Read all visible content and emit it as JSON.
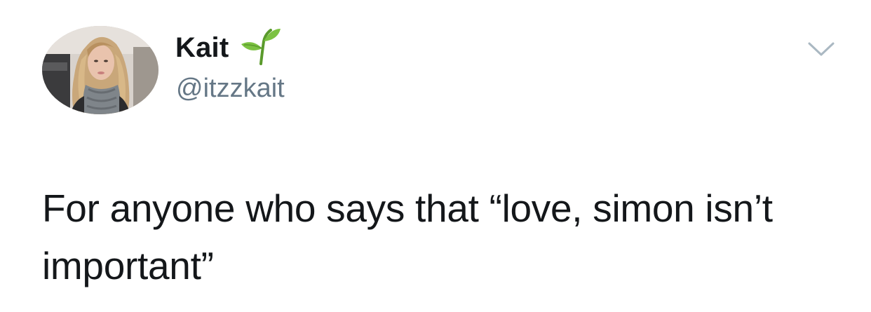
{
  "tweet": {
    "author": {
      "display_name": "Kait",
      "handle": "@itzzkait",
      "name_emoji": "seedling-icon"
    },
    "text": "For anyone who says that “love, simon isn’t important”",
    "menu_icon": "chevron-down-icon"
  },
  "colors": {
    "text": "#14171a",
    "handle": "#657786",
    "chevron": "#aab8c2",
    "seedling": "#7cc242",
    "background": "#ffffff"
  }
}
